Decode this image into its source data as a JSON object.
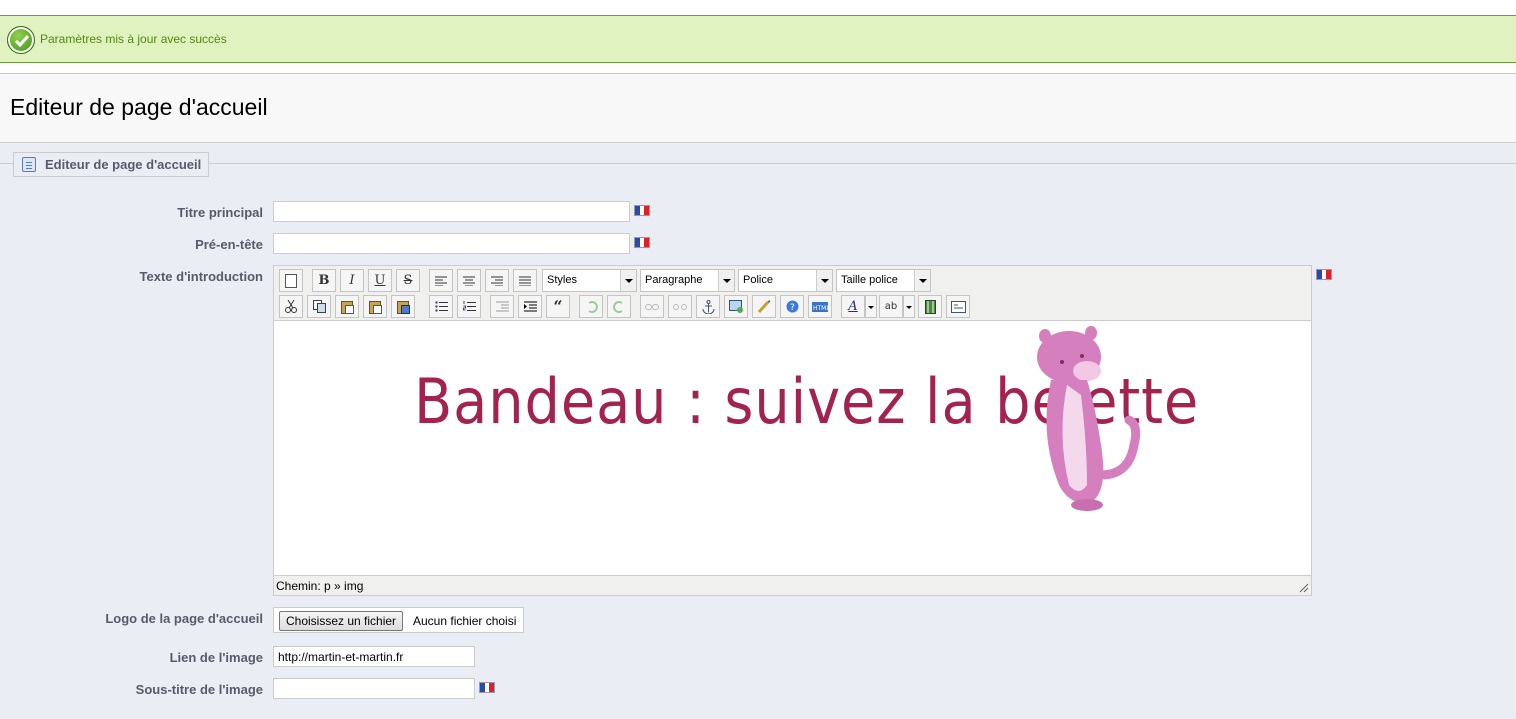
{
  "notification": {
    "message": "Paramètres mis à jour avec succès",
    "icon": "check-circle-icon"
  },
  "header": {
    "title": "Editeur de page d'accueil"
  },
  "fieldset": {
    "legend": "Editeur de page d'accueil",
    "icon": "document-icon"
  },
  "form": {
    "titre_principal": {
      "label": "Titre principal",
      "value": ""
    },
    "pre_en_tete": {
      "label": "Pré-en-tête",
      "value": ""
    },
    "texte_intro": {
      "label": "Texte d'introduction"
    },
    "logo": {
      "label": "Logo de la page d'accueil",
      "button": "Choisissez un fichier",
      "status": "Aucun fichier choisi"
    },
    "lien_image": {
      "label": "Lien de l'image",
      "value": "http://martin-et-martin.fr"
    },
    "sous_titre": {
      "label": "Sous-titre de l'image",
      "value": ""
    }
  },
  "editor": {
    "dropdowns": {
      "styles": "Styles",
      "format": "Paragraphe",
      "font": "Police",
      "size": "Taille police"
    },
    "status_path": "Chemin: p » img",
    "content": {
      "banner_text": "Bandeau : suivez la belette",
      "image": "weasel-mascot-image"
    }
  },
  "colors": {
    "success_bg": "#dff2bf",
    "success_text": "#4f8a10",
    "banner_text": "#a3234f",
    "weasel": "#d67fbf"
  }
}
